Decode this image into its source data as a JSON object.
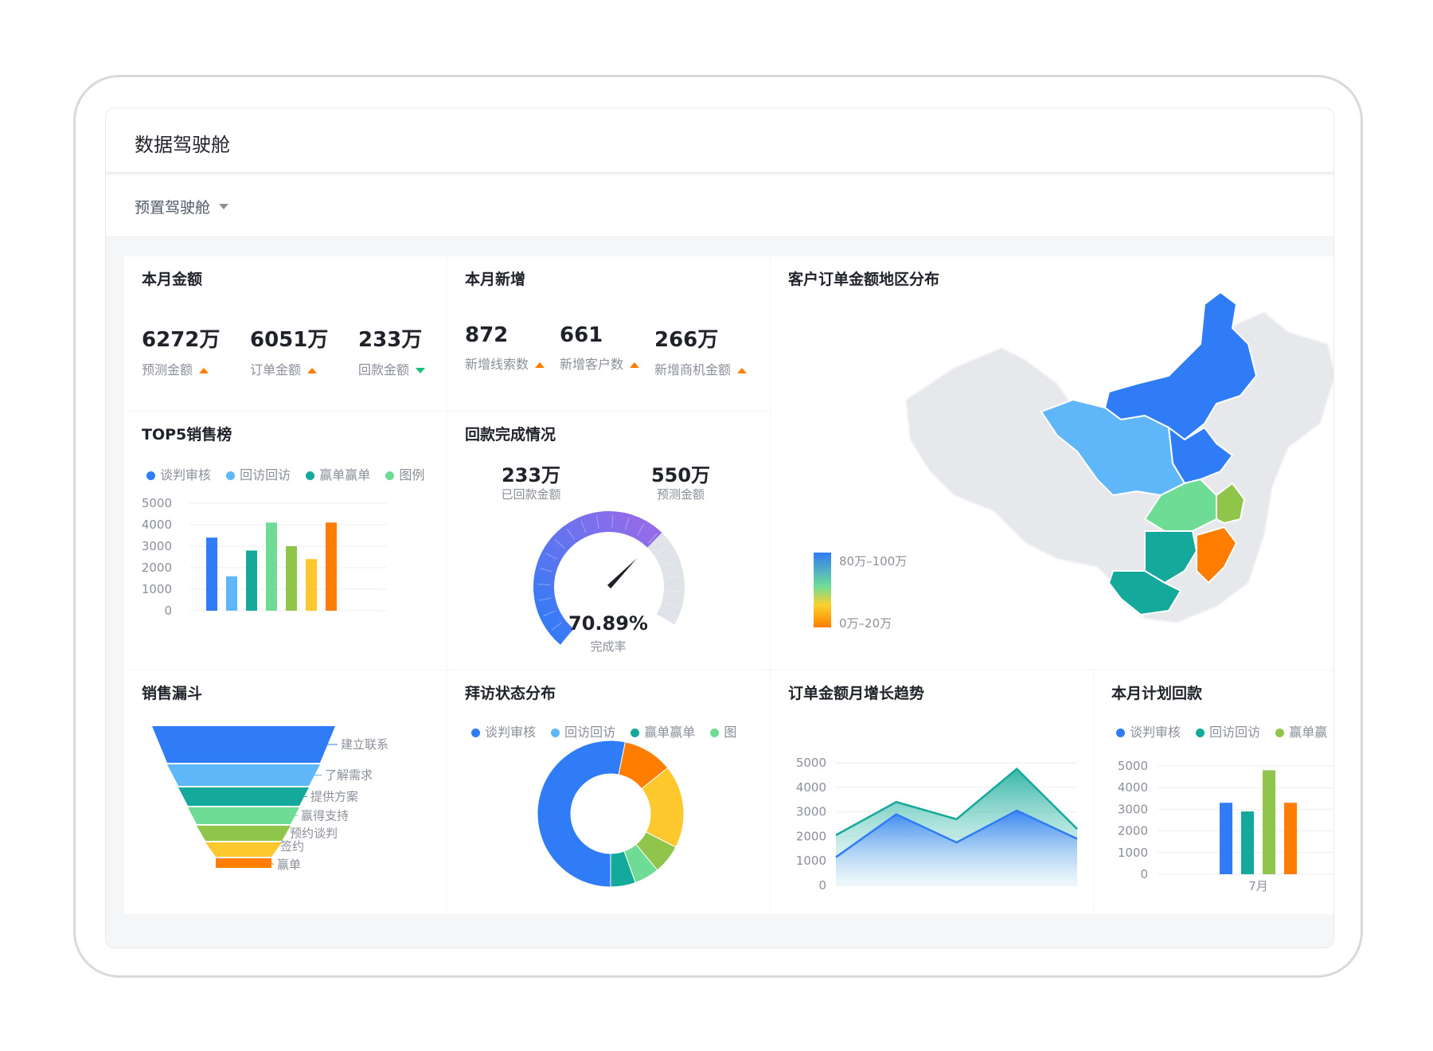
{
  "header": {
    "title": "数据驾驶舱"
  },
  "toolbar": {
    "cockpit_select": "预置驾驶舱"
  },
  "month_amount": {
    "title": "本月金额",
    "kpis": [
      {
        "value": "6272万",
        "label": "预测金额",
        "trend": "up"
      },
      {
        "value": "6051万",
        "label": "订单金额",
        "trend": "up"
      },
      {
        "value": "233万",
        "label": "回款金额",
        "trend": "down"
      }
    ]
  },
  "month_new": {
    "title": "本月新增",
    "kpis": [
      {
        "value": "872",
        "label": "新增线索数",
        "trend": "up"
      },
      {
        "value": "661",
        "label": "新增客户数",
        "trend": "up"
      },
      {
        "value": "266万",
        "label": "新增商机金额",
        "trend": "up"
      }
    ]
  },
  "map": {
    "title": "客户订单金额地区分布",
    "legend_high": "80万–100万",
    "legend_low": "0万–20万",
    "colors": {
      "high": "#2f7cf6",
      "mid": "#8fd14f",
      "low": "#ff7d00"
    }
  },
  "top5": {
    "title": "TOP5销售榜",
    "legend": [
      {
        "name": "谈判审核",
        "color": "#2f7cf6"
      },
      {
        "name": "回访回访",
        "color": "#5fb6f8"
      },
      {
        "name": "赢单赢单",
        "color": "#14a99a"
      },
      {
        "name": "图例",
        "color": "#6fdc96"
      }
    ]
  },
  "payment": {
    "title": "回款完成情况",
    "received_value": "233万",
    "received_label": "已回款金额",
    "forecast_value": "550万",
    "forecast_label": "预测金额",
    "rate": "70.89%",
    "rate_label": "完成率",
    "rate_fraction": 0.7089
  },
  "funnel": {
    "title": "销售漏斗",
    "stages": [
      {
        "name": "建立联系",
        "color": "#2f7cf6"
      },
      {
        "name": "了解需求",
        "color": "#5fb6f8"
      },
      {
        "name": "提供方案",
        "color": "#14a99a"
      },
      {
        "name": "赢得支持",
        "color": "#6fdc96"
      },
      {
        "name": "预约谈判",
        "color": "#8fc54a"
      },
      {
        "name": "签约",
        "color": "#fcc82e"
      },
      {
        "name": "赢单",
        "color": "#ff7d00"
      }
    ]
  },
  "visit": {
    "title": "拜访状态分布",
    "legend": [
      {
        "name": "谈判审核",
        "color": "#2f7cf6"
      },
      {
        "name": "回访回访",
        "color": "#5fb6f8"
      },
      {
        "name": "赢单赢单",
        "color": "#14a99a"
      },
      {
        "name": "图",
        "color": "#6fdc96"
      }
    ]
  },
  "trend": {
    "title": "订单金额月增长趋势"
  },
  "plan": {
    "title": "本月计划回款",
    "legend": [
      {
        "name": "谈判审核",
        "color": "#2f7cf6"
      },
      {
        "name": "回访回访",
        "color": "#14a99a"
      },
      {
        "name": "赢单赢",
        "color": "#8fc54a"
      }
    ]
  },
  "chart_data": [
    {
      "type": "bar",
      "categories": [
        "",
        "",
        "",
        "",
        "",
        "",
        ""
      ],
      "values": [
        3400,
        1600,
        2800,
        4100,
        3000,
        2400,
        4100
      ],
      "colors": [
        "#2f7cf6",
        "#5fb6f8",
        "#14a99a",
        "#6fdc96",
        "#8fc54a",
        "#fcc82e",
        "#ff7d00"
      ],
      "ylim": [
        0,
        5000
      ],
      "yticks": [
        0,
        1000,
        2000,
        3000,
        4000,
        5000
      ],
      "grid": true
    },
    {
      "type": "pie",
      "donut": true,
      "values": [
        58,
        12,
        20,
        7,
        6,
        6
      ],
      "colors": [
        "#2f7cf6",
        "#ff7d00",
        "#fcc82e",
        "#8fc54a",
        "#6fdc96",
        "#14a99a"
      ]
    },
    {
      "type": "area",
      "x": [
        1,
        2,
        3,
        4,
        5
      ],
      "series": [
        {
          "values": [
            2050,
            3400,
            2700,
            4750,
            2300
          ],
          "color": "#14a99a"
        },
        {
          "values": [
            1150,
            2900,
            1750,
            3050,
            1900
          ],
          "color": "#2f7cf6"
        }
      ],
      "ylim": [
        0,
        5000
      ],
      "yticks": [
        0,
        1000,
        2000,
        3000,
        4000,
        5000
      ],
      "grid": true
    },
    {
      "type": "bar",
      "categories": [
        "7月"
      ],
      "series": [
        {
          "name": "谈判审核",
          "values": [
            3300
          ],
          "color": "#2f7cf6"
        },
        {
          "name": "回访回访",
          "values": [
            2900
          ],
          "color": "#14a99a"
        },
        {
          "name": "赢单赢",
          "values": [
            4800
          ],
          "color": "#8fc54a"
        },
        {
          "values": [
            3300
          ],
          "color": "#ff7d00"
        }
      ],
      "ylim": [
        0,
        5000
      ],
      "yticks": [
        0,
        1000,
        2000,
        3000,
        4000,
        5000
      ],
      "grid": true
    }
  ]
}
